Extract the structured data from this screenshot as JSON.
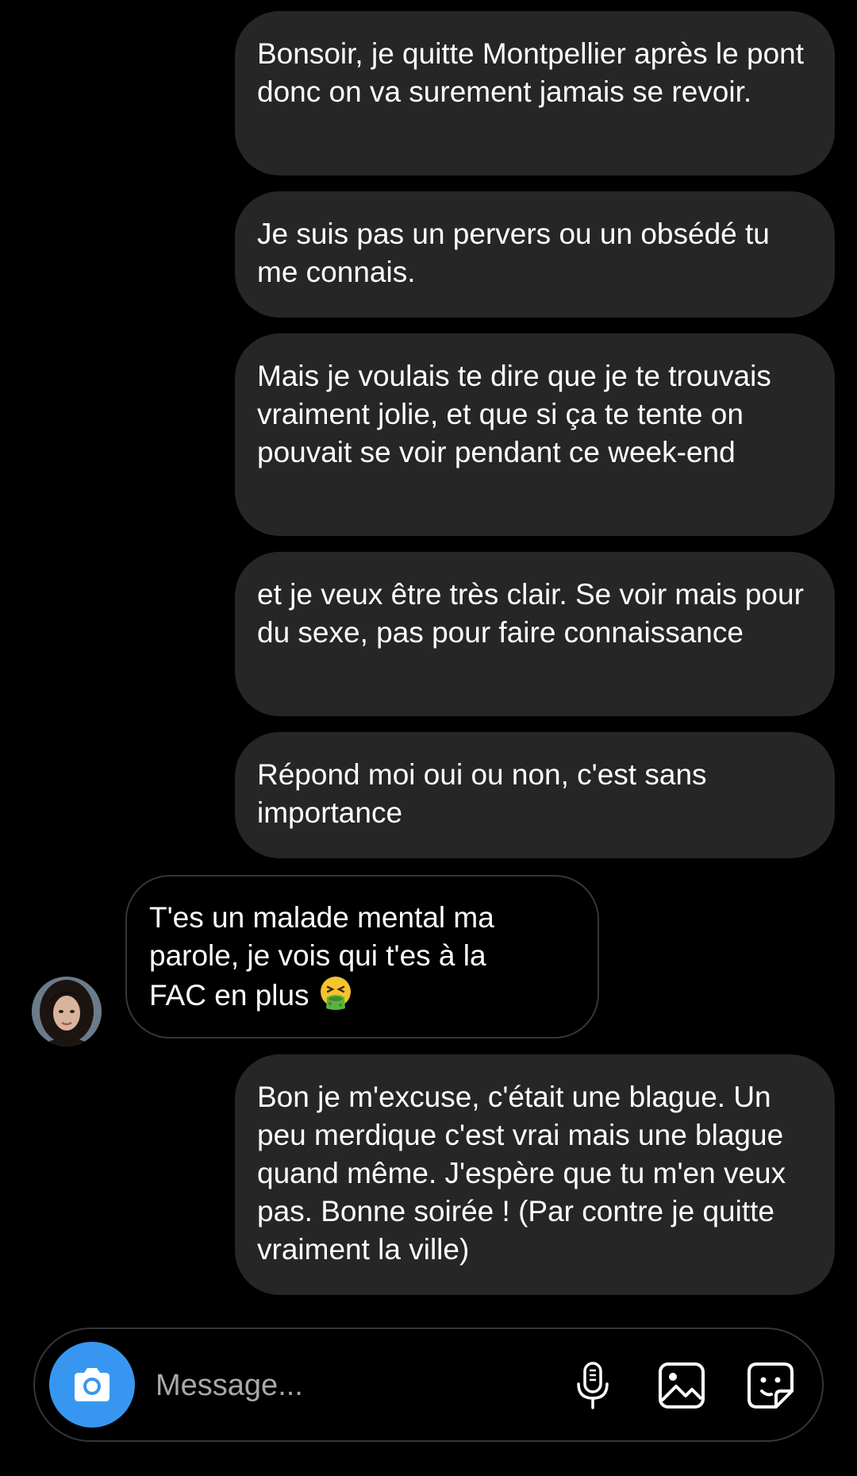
{
  "conversation": {
    "messages": [
      {
        "from": "me",
        "text": "Bonsoir, je quitte Montpellier après le pont donc on va surement jamais se revoir."
      },
      {
        "from": "me",
        "text": "Je suis pas un pervers ou un obsédé tu me connais."
      },
      {
        "from": "me",
        "text": "Mais je voulais te dire que je te trouvais vraiment jolie, et que si ça te tente on pouvait se voir pendant ce week-end"
      },
      {
        "from": "me",
        "text": "et je veux être très clair. Se voir mais pour du sexe, pas pour faire connaissance"
      },
      {
        "from": "me",
        "text": "Répond moi oui ou non, c'est sans importance"
      },
      {
        "from": "them",
        "text_line1": "T'es un malade mental ma",
        "text_line2": "parole, je vois qui t'es à la",
        "text_line3": "FAC en plus",
        "emoji": "face-vomiting-emoji"
      },
      {
        "from": "me",
        "text": "Bon je m'excuse, c'était une blague. Un peu merdique c'est vrai mais une blague quand même. J'espère que tu m'en veux pas. Bonne soirée ! (Par contre je quitte vraiment la ville)"
      }
    ]
  },
  "composer": {
    "placeholder": "Message...",
    "icons": [
      "camera-icon",
      "microphone-icon",
      "gallery-icon",
      "sticker-icon"
    ]
  },
  "colors": {
    "background": "#000000",
    "sent_bubble": "#262626",
    "received_border": "#363636",
    "camera_button": "#3797f0",
    "text": "#ffffff",
    "placeholder": "#a8a8a8"
  }
}
